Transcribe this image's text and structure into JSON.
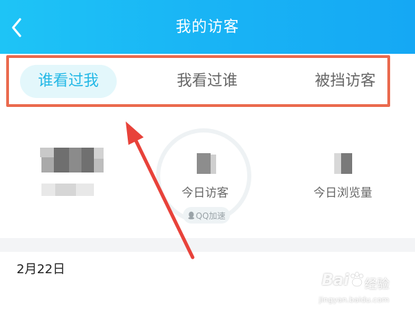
{
  "header": {
    "title": "我的访客",
    "back_icon": "chevron-left-icon",
    "gradient_start": "#1ec4f6",
    "gradient_end": "#15a8f4"
  },
  "tabs": [
    {
      "label": "谁看过我",
      "active": true
    },
    {
      "label": "我看过谁",
      "active": false
    },
    {
      "label": "被挡访客",
      "active": false
    }
  ],
  "stats": {
    "today_visitors_label": "今日访客",
    "today_views_label": "今日浏览量",
    "qq_speed_label": "QQ加速",
    "qq_icon": "penguin-icon"
  },
  "list": {
    "date": "2月22日"
  },
  "annotation": {
    "highlight_color": "#ea6a4e",
    "arrow_color": "#e8423a"
  },
  "watermark": {
    "brand": "Bai",
    "brand_suffix": "经验",
    "url": "jingyan.baidu.com"
  }
}
